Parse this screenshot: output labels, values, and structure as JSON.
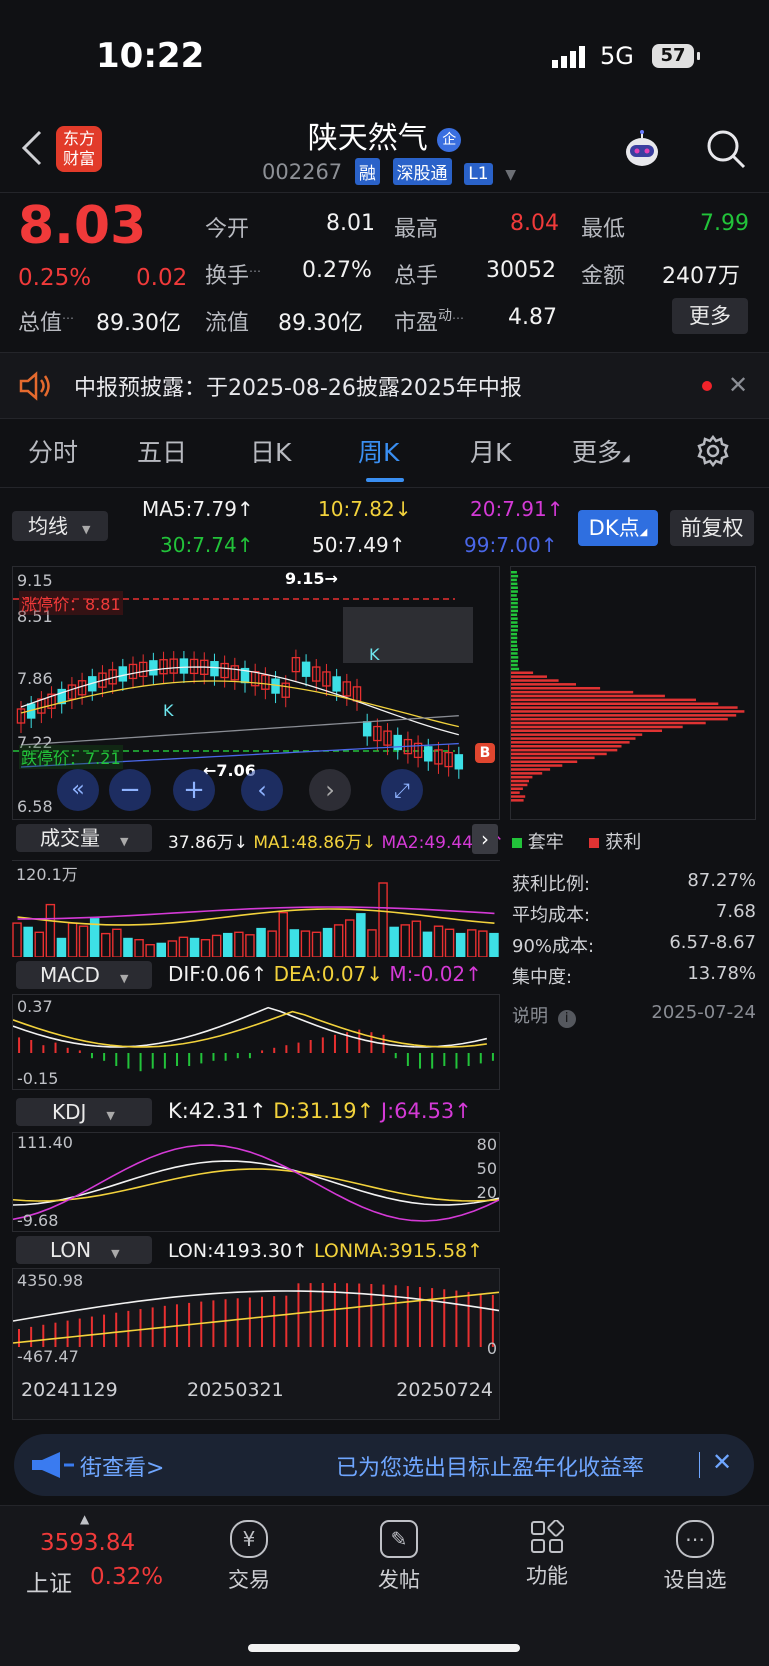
{
  "status": {
    "time": "10:22",
    "network": "5G",
    "battery": "57"
  },
  "header": {
    "app_logo_top": "东方",
    "app_logo_bottom": "财富",
    "stock_name": "陕天然气",
    "ent_badge": "企",
    "code": "002267",
    "tags": [
      "融",
      "深股通",
      "L1"
    ]
  },
  "quote": {
    "price": "8.03",
    "change_pct": "0.25%",
    "change": "0.02",
    "open_label": "今开",
    "open": "8.01",
    "high_label": "最高",
    "high": "8.04",
    "low_label": "最低",
    "low": "7.99",
    "turnover_label": "换手",
    "turnover": "0.27%",
    "volume_label": "总手",
    "volume": "30052",
    "amount_label": "金额",
    "amount": "2407万",
    "mktcap_label": "总值",
    "mktcap": "89.30亿",
    "float_label": "流值",
    "float": "89.30亿",
    "pe_label": "市盈",
    "pe_sup": "动",
    "pe": "4.87",
    "more_button": "更多"
  },
  "notice": {
    "text": "中报预披露：于2025-08-26披露2025年中报"
  },
  "tabs": [
    "分时",
    "五日",
    "日K",
    "周K",
    "月K",
    "更多"
  ],
  "active_tab": "周K",
  "chart_header": {
    "ma_select": "均线",
    "ma5": "MA5:7.79↑",
    "ma10": "10:7.82↓",
    "ma20": "20:7.91↑",
    "ma30": "30:7.74↑",
    "ma50": "50:7.49↑",
    "ma99": "99:7.00↑",
    "dk_button": "DK点",
    "adjust_button": "前复权"
  },
  "kline": {
    "y_labels": [
      "9.15",
      "8.51",
      "7.86",
      "7.22",
      "6.58"
    ],
    "limit_up": "涨停价：8.81",
    "limit_down": "跌停价：7.21",
    "peak_label": "9.15→",
    "trough_label": "←7.06",
    "badge_b": "B",
    "k_label": "K"
  },
  "chart_data": [
    {
      "type": "bar",
      "title": "成交量",
      "labels": [
        "37.86万↓",
        "MA1:48.86万↓",
        "MA2:49.44万↑"
      ],
      "y_max_label": "120.1万",
      "values": [
        55,
        48,
        40,
        85,
        30,
        55,
        50,
        62,
        38,
        45,
        30,
        28,
        20,
        22,
        26,
        32,
        30,
        28,
        35,
        38,
        40,
        36,
        46,
        42,
        72,
        44,
        42,
        40,
        46,
        52,
        60,
        70,
        44,
        120,
        48,
        52,
        58,
        40,
        50,
        45,
        38,
        44,
        42,
        38
      ]
    },
    {
      "type": "bar",
      "title": "MACD",
      "labels": [
        "DIF:0.06↑",
        "DEA:0.07↓",
        "M:-0.02↑"
      ],
      "y_labels": [
        "0.37",
        "-0.15"
      ],
      "values": [
        0.06,
        0.05,
        0.03,
        0.04,
        0.02,
        0.01,
        -0.02,
        -0.03,
        -0.05,
        -0.06,
        -0.07,
        -0.06,
        -0.06,
        -0.05,
        -0.05,
        -0.04,
        -0.03,
        -0.03,
        -0.02,
        -0.02,
        0.01,
        0.02,
        0.03,
        0.04,
        0.05,
        0.06,
        0.07,
        0.08,
        0.09,
        0.08,
        0.07,
        -0.02,
        -0.05,
        -0.06,
        -0.06,
        -0.05,
        -0.06,
        -0.05,
        -0.04,
        -0.03
      ]
    },
    {
      "type": "line",
      "title": "KDJ",
      "labels": [
        "K:42.31↑",
        "D:31.19↑",
        "J:64.53↑"
      ],
      "y_labels": [
        "111.40",
        "-9.68"
      ],
      "right_labels": [
        "80",
        "50",
        "20"
      ]
    },
    {
      "type": "bar",
      "title": "LON",
      "labels": [
        "LON:4193.30↑",
        "LONMA:3915.58↑"
      ],
      "y_labels": [
        "4350.98",
        "-467.47"
      ],
      "right_labels": [
        "0"
      ],
      "x_labels": [
        "20241129",
        "20250321",
        "20250724"
      ]
    }
  ],
  "chip": {
    "legend_trap": "套牢",
    "legend_profit": "获利",
    "rows": [
      {
        "label": "获利比例:",
        "value": "87.27%"
      },
      {
        "label": "平均成本:",
        "value": "7.68"
      },
      {
        "label": "90%成本:",
        "value": "6.57-8.67"
      },
      {
        "label": "集中度:",
        "value": "13.78%"
      }
    ],
    "note_label": "说明",
    "date": "2025-07-24"
  },
  "ticker": {
    "left": "街查看>",
    "right": "已为您选出目标止盈年化收益率"
  },
  "bottom_nav": {
    "index_value": "3593.84",
    "index_name": "上证",
    "index_change": "0.32%",
    "items": [
      "交易",
      "发帖",
      "功能",
      "设自选"
    ]
  }
}
